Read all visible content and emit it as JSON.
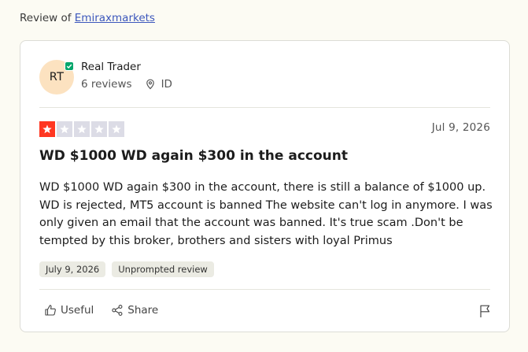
{
  "header": {
    "prefix": "Review of",
    "company_link": "Emiraxmarkets"
  },
  "reviewer": {
    "initials": "RT",
    "name": "Real Trader",
    "reviews_count": "6 reviews",
    "location": "ID",
    "avatar_color": "#fce2c0",
    "verified_color": "#04a66b"
  },
  "review": {
    "rating": 1,
    "max_rating": 5,
    "star_fill_color": "#ff3722",
    "star_empty_color": "#dcdce6",
    "date": "Jul 9, 2026",
    "title": "WD $1000 WD again $300 in the account",
    "body": "WD $1000 WD again $300 in the account, there is still a balance of $1000 up. WD is rejected, MT5 account is banned The website can't log in anymore. I was only given an email that the account was banned. It's true scam .Don't be tempted by this broker, brothers and sisters with loyal Primus",
    "tags": [
      "July 9, 2026",
      "Unprompted review"
    ]
  },
  "actions": {
    "useful_label": "Useful",
    "share_label": "Share"
  }
}
